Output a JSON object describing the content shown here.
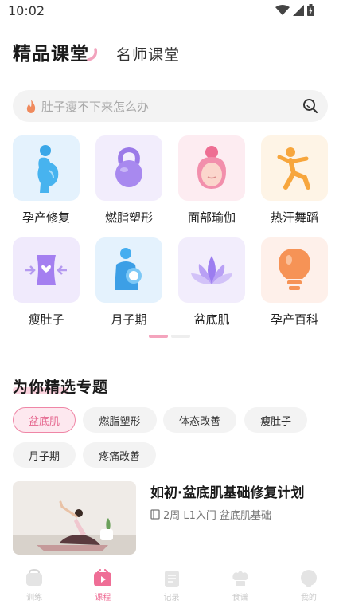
{
  "status_bar": {
    "time": "10:02",
    "icons": [
      "wifi-icon",
      "signal-icon",
      "battery-icon"
    ]
  },
  "header": {
    "tabs": [
      {
        "label": "精品课堂",
        "active": true
      },
      {
        "label": "名师课堂",
        "active": false
      }
    ]
  },
  "search": {
    "placeholder": "肚子瘦不下来怎么办",
    "icons": [
      "flame-icon",
      "search-icon"
    ]
  },
  "categories": [
    {
      "label": "孕产修复",
      "icon": "pregnant-woman-icon"
    },
    {
      "label": "燃脂塑形",
      "icon": "kettlebell-icon"
    },
    {
      "label": "面部瑜伽",
      "icon": "face-icon"
    },
    {
      "label": "热汗舞蹈",
      "icon": "dancer-icon"
    },
    {
      "label": "瘦肚子",
      "icon": "waist-slim-icon"
    },
    {
      "label": "月子期",
      "icon": "mother-baby-icon"
    },
    {
      "label": "盆底肌",
      "icon": "lotus-icon"
    },
    {
      "label": "孕产百科",
      "icon": "lightbulb-icon"
    }
  ],
  "pager": {
    "pages": 2,
    "current": 1
  },
  "featured": {
    "title": "为你精选专题",
    "chips": [
      {
        "label": "盆底肌",
        "active": true
      },
      {
        "label": "燃脂塑形",
        "active": false
      },
      {
        "label": "体态改善",
        "active": false
      },
      {
        "label": "瘦肚子",
        "active": false
      },
      {
        "label": "月子期",
        "active": false
      },
      {
        "label": "疼痛改善",
        "active": false
      }
    ]
  },
  "course": {
    "title": "如初·盆底肌基础修复计划",
    "meta": "2周 L1入门 盆底肌基础",
    "meta_icon": "book-icon"
  },
  "bottom_nav": [
    {
      "label": "训练",
      "icon": "training-icon",
      "active": false
    },
    {
      "label": "课程",
      "icon": "course-play-icon",
      "active": true
    },
    {
      "label": "记录",
      "icon": "notebook-icon",
      "active": false
    },
    {
      "label": "食谱",
      "icon": "chef-hat-icon",
      "active": false
    },
    {
      "label": "我的",
      "icon": "profile-icon",
      "active": false
    }
  ],
  "colors": {
    "accent_pink": "#ef6e96",
    "chip_active_bg": "#fde8ef",
    "search_bg": "#f3f3f3"
  }
}
